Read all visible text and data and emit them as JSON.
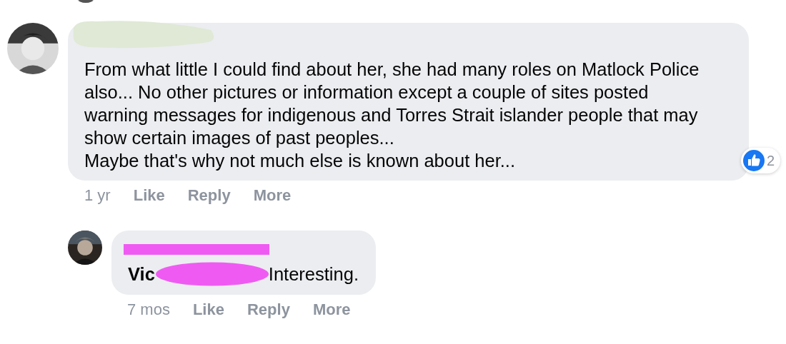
{
  "comments": [
    {
      "paragraphs": [
        "From what little I could find about her, she had many roles on Matlock Police also... No other pictures or information except a couple of sites posted warning messages for indigenous and Torres Strait islander people that may show certain images of past peoples...",
        "Maybe that's why not much else is known about her..."
      ],
      "reactions": {
        "count": "2"
      },
      "time": "1 yr",
      "actions": [
        "Like",
        "Reply",
        "More"
      ],
      "replies": [
        {
          "mention": "Vic",
          "paragraphs": [
            "Interesting."
          ],
          "time": "7 mos",
          "actions": [
            "Like",
            "Reply",
            "More"
          ]
        }
      ]
    }
  ]
}
